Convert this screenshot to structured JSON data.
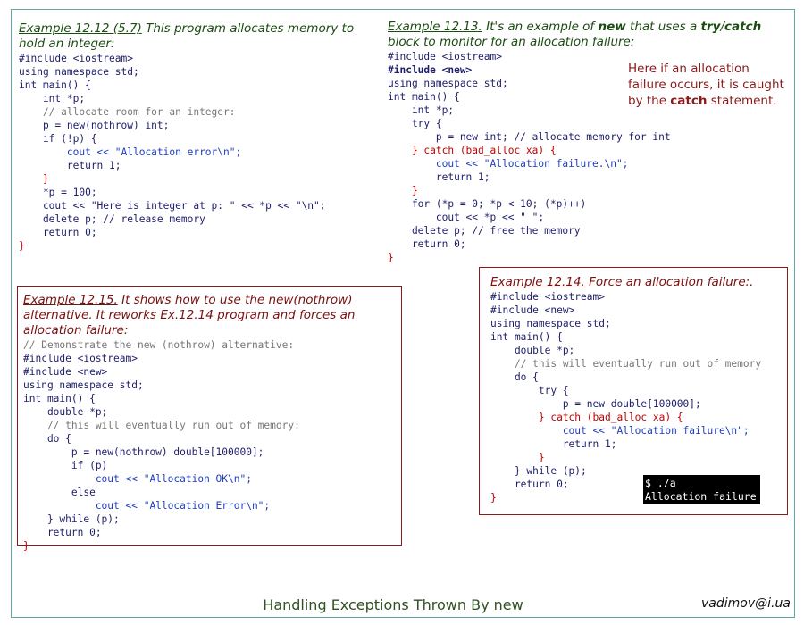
{
  "ex1": {
    "label": "Example 12.12 (5.7)",
    "text": " This program allocates memory to hold an integer:",
    "lines": [
      "#include <iostream>",
      "using namespace std;",
      "int main() {",
      "    int *p;",
      "    // allocate room for an integer:",
      "    p = new(nothrow) int;",
      "    if (!p) {",
      "        cout << \"Allocation error\\n\";",
      "        return 1;",
      "    }",
      "    *p = 100;",
      "    cout << \"Here is integer at p: \" << *p << \"\\n\";",
      "    delete p; // release memory",
      "    return 0;",
      "}"
    ]
  },
  "ex2": {
    "label": "Example 12.13.",
    "text_a": " It's an example of ",
    "text_new": "new",
    "text_b": " that uses a ",
    "text_try": "try",
    "text_slash": "/",
    "text_catch": "catch",
    "text_c": " block to monitor for an allocation failure:",
    "lines": [
      "#include <iostream>",
      "#include <new>",
      "using namespace std;",
      "int main() {",
      "    int *p;",
      "    try {",
      "        p = new int; // allocate memory for int",
      "    } catch (bad_alloc xa) {",
      "        cout << \"Allocation failure.\\n\";",
      "        return 1;",
      "    }",
      "    for (*p = 0; *p < 10; (*p)++)",
      "        cout << *p << \" \";",
      "    delete p; // free the memory",
      "    return 0;",
      "}"
    ]
  },
  "note": {
    "text_a": "Here if an allocation failure occurs, it is caught by the ",
    "text_catch": "catch",
    "text_b": " statement."
  },
  "ex3": {
    "label": "Example 12.15.",
    "text": " It shows how to use the new(nothrow) alternative. It reworks Ex.12.14 program and forces an allocation failure:",
    "lines": [
      "// Demonstrate the new (nothrow) alternative:",
      "#include <iostream>",
      "#include <new>",
      "using namespace std;",
      "int main() {",
      "    double *p;",
      "    // this will eventually run out of memory:",
      "    do {",
      "        p = new(nothrow) double[100000];",
      "        if (p)",
      "            cout << \"Allocation OK\\n\";",
      "        else",
      "            cout << \"Allocation Error\\n\";",
      "    } while (p);",
      "    return 0;",
      "}"
    ]
  },
  "ex4": {
    "label": "Example 12.14.",
    "text": " Force an allocation failure:.",
    "lines": [
      "#include <iostream>",
      "#include <new>",
      "using namespace std;",
      "int main() {",
      "    double *p;",
      "    // this will eventually run out of memory",
      "    do {",
      "        try {",
      "            p = new double[100000];",
      "        } catch (bad_alloc xa) {",
      "            cout << \"Allocation failure\\n\";",
      "            return 1;",
      "        }",
      "    } while (p);",
      "    return 0;",
      "}"
    ]
  },
  "terminal": {
    "line1": "$ ./a",
    "line2": "Allocation failure"
  },
  "footer": {
    "title": "Handling Exceptions Thrown By new",
    "email": "vadimov@i.ua"
  }
}
